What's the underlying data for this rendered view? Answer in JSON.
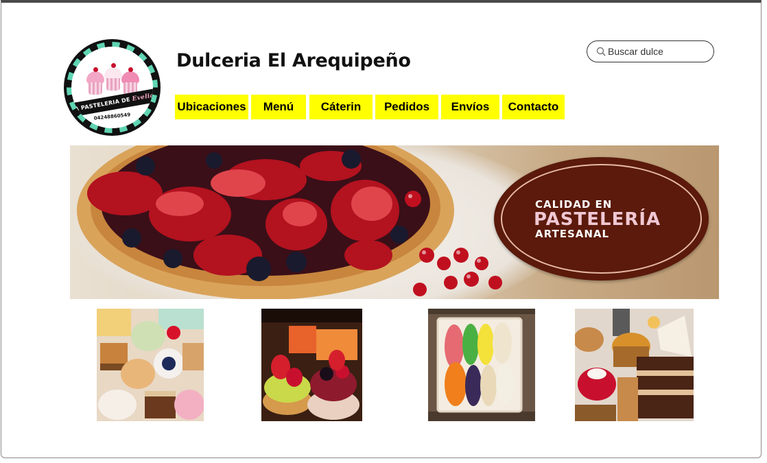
{
  "header": {
    "site_title": "Dulceria El Arequipeño",
    "search": {
      "placeholder": "Buscar dulce",
      "value": ""
    }
  },
  "logo": {
    "banner_text": "LA PASTELERIA DE",
    "script_text": "Evelia",
    "phone": "04248860549"
  },
  "nav": {
    "items": [
      {
        "label": "Ubicaciones"
      },
      {
        "label": "Menú"
      },
      {
        "label": "Cáterin"
      },
      {
        "label": "Pedidos"
      },
      {
        "label": "Envíos"
      },
      {
        "label": "Contacto"
      }
    ],
    "color": "#ffff00"
  },
  "hero": {
    "line1": "CALIDAD EN",
    "line2": "PASTELERÍA",
    "line3": "ARTESANAL",
    "badge_color": "#5b1a0b"
  },
  "thumbnails": [
    {
      "icon": "assorted-pastries-image"
    },
    {
      "icon": "fruit-tarts-image"
    },
    {
      "icon": "macarons-box-image"
    },
    {
      "icon": "cake-slices-image"
    }
  ]
}
